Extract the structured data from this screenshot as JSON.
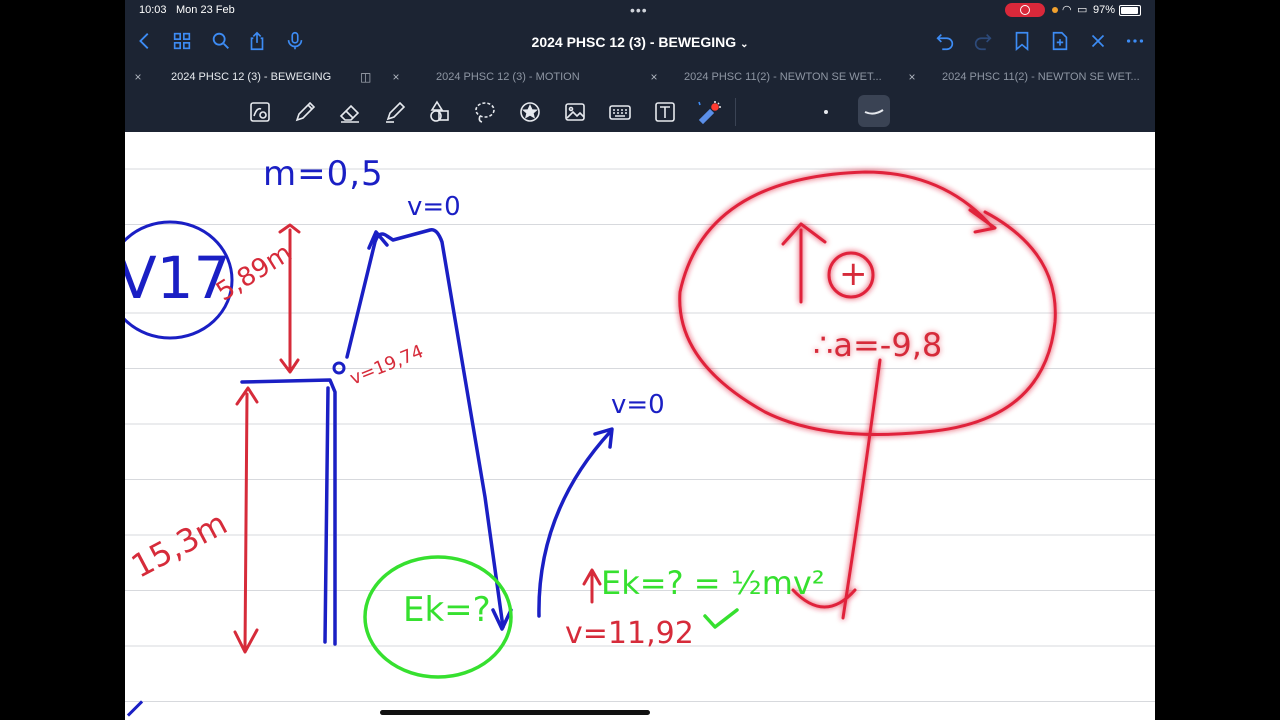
{
  "status_bar": {
    "time": "10:03",
    "date": "Mon 23 Feb",
    "battery": "97%"
  },
  "nav": {
    "title": "2024 PHSC 12 (3) - BEWEGING"
  },
  "tabs": [
    {
      "label": "2024 PHSC 12 (3) - BEWEGING",
      "active": true
    },
    {
      "label": "2024 PHSC 12 (3) - MOTION",
      "active": false
    },
    {
      "label": "2024 PHSC 11(2) - NEWTON SE WET...",
      "active": false
    },
    {
      "label": "2024 PHSC 11(2) - NEWTON SE WET...",
      "active": false
    }
  ],
  "toolbar": {
    "tools": [
      "lasso-zoom",
      "pen",
      "eraser",
      "highlighter",
      "shapes",
      "lasso",
      "sticker",
      "image",
      "keyboard",
      "text",
      "laser-pointer",
      "dot-thickness",
      "curve-stroke"
    ]
  },
  "notes": {
    "mass": "m=0,5",
    "label_v17": "V17",
    "height_top": "5,89m",
    "height_bottom": "15,3m",
    "v_top": "v=0",
    "v_mid": "v=19,74",
    "v_right": "v=0",
    "ek_circle": "Ek=?",
    "ek_formula": "Ek=? = ½mv²",
    "v_result": "v=11,92",
    "upward_symbol": "↑",
    "positive": "+",
    "accel": "∴a=-9,8"
  },
  "colors": {
    "blue": "#1a1fc4",
    "red": "#d62b3a",
    "green": "#36e02f",
    "bg_dark": "#1c2433",
    "accent": "#3d8cf5"
  }
}
